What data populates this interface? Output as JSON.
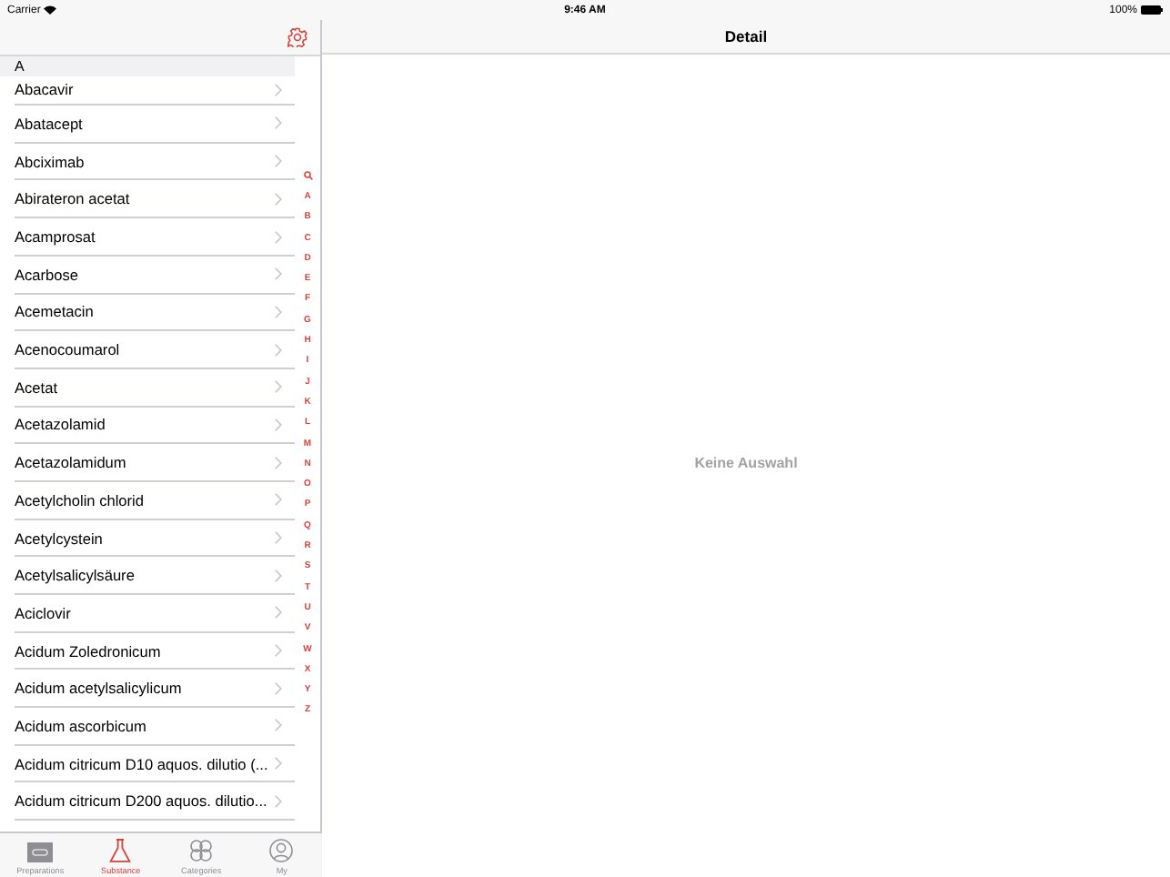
{
  "status_bar": {
    "carrier": "Carrier",
    "time": "9:46 AM",
    "battery": "100%"
  },
  "master": {
    "section": "A",
    "items": [
      "Abacavir",
      "Abatacept",
      "Abciximab",
      "Abirateron acetat",
      "Acamprosat",
      "Acarbose",
      "Acemetacin",
      "Acenocoumarol",
      "Acetat",
      "Acetazolamid",
      "Acetazolamidum",
      "Acetylcholin chlorid",
      "Acetylcystein",
      "Acetylsalicylsäure",
      "Aciclovir",
      "Acidum Zoledronicum",
      "Acidum acetylsalicylicum",
      "Acidum ascorbicum",
      "Acidum citricum D10 aquos. dilutio (...",
      "Acidum citricum D200 aquos. dilutio..."
    ],
    "index": [
      "A",
      "B",
      "C",
      "D",
      "E",
      "F",
      "G",
      "H",
      "I",
      "J",
      "K",
      "L",
      "M",
      "N",
      "O",
      "P",
      "Q",
      "R",
      "S",
      "T",
      "U",
      "V",
      "W",
      "X",
      "Y",
      "Z"
    ]
  },
  "detail": {
    "title": "Detail",
    "empty_text": "Keine Auswahl"
  },
  "tabs": [
    {
      "kind": "preparations",
      "label": "Preparations",
      "selected": false
    },
    {
      "kind": "substance",
      "label": "Substance",
      "selected": true
    },
    {
      "kind": "categories",
      "label": "Categories",
      "selected": false
    },
    {
      "kind": "my",
      "label": "My",
      "selected": false
    }
  ]
}
